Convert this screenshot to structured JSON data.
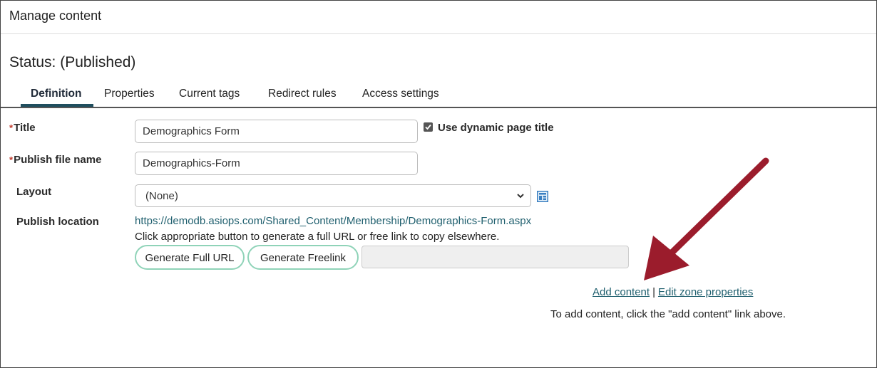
{
  "header": {
    "title": "Manage content"
  },
  "status": {
    "text": "Status: (Published)"
  },
  "tabs": [
    {
      "label": "Definition",
      "active": true
    },
    {
      "label": "Properties",
      "active": false
    },
    {
      "label": "Current tags",
      "active": false
    },
    {
      "label": "Redirect rules",
      "active": false
    },
    {
      "label": "Access settings",
      "active": false
    }
  ],
  "form": {
    "title_label": "Title",
    "title_value": "Demographics Form",
    "dynamic_title_label": "Use dynamic page title",
    "dynamic_title_checked": true,
    "publish_file_label": "Publish file name",
    "publish_file_value": "Demographics-Form",
    "layout_label": "Layout",
    "layout_value": "(None)",
    "publish_location_label": "Publish location",
    "publish_location_url": "https://demodb.asiops.com/Shared_Content/Membership/Demographics-Form.aspx",
    "publish_hint": "Click appropriate button to generate a full URL or free link to copy elsewhere.",
    "generate_full_url": "Generate Full URL",
    "generate_freelink": "Generate Freelink",
    "generated_value": ""
  },
  "zone": {
    "add_content": "Add content",
    "separator": "|",
    "edit_zone": "Edit zone properties",
    "instruction": "To add content, click the \"add content\" link above."
  },
  "colors": {
    "accent": "#1f4e5e",
    "link": "#1f5f6e",
    "button_border": "#8fd3b8",
    "arrow": "#9b1c2c",
    "required": "#c0392b"
  }
}
